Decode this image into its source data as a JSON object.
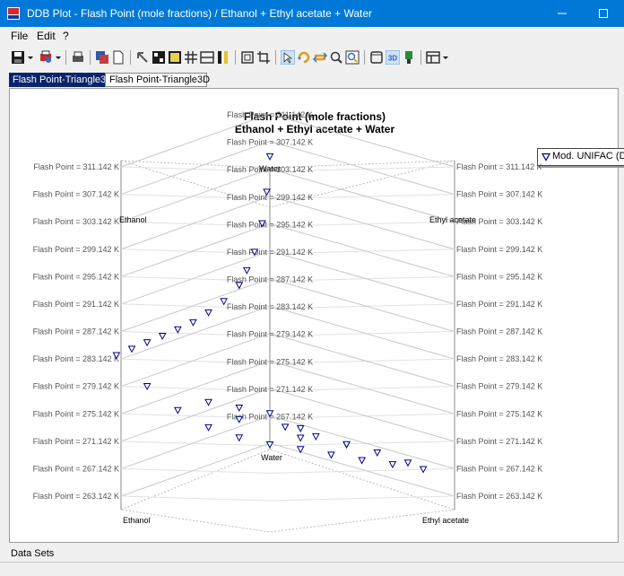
{
  "window": {
    "title": "DDB Plot - Flash Point (mole fractions) / Ethanol + Ethyl acetate + Water",
    "accent": "#0078d7"
  },
  "menu": [
    "File",
    "Edit",
    "?"
  ],
  "toolbar": {
    "icons": [
      "save-icon",
      "dropdown-arrow-icon",
      "print-preview-icon",
      "dropdown-arrow-icon",
      "print-icon",
      "copy-icon",
      "new-page-icon",
      "pointer-icon",
      "grid-small-icon",
      "grid-yellow-icon",
      "grid-icon",
      "table-icon",
      "columns-icon",
      "frame-icon",
      "crop-icon",
      "select-arrow-icon",
      "rotate-icon",
      "move-icon",
      "zoom-icon",
      "zoom-box-icon",
      "window-icon",
      "3d-icon",
      "color-icon",
      "layout-icon",
      "dropdown-arrow-icon"
    ],
    "3d_label": "3D"
  },
  "tabs": [
    "Flash Point-Triangle3D",
    "Flash Point-Triangle3D"
  ],
  "chart_data": {
    "type": "scatter",
    "projection": "ternary-3d",
    "title": "Flash Point (mole fractions)",
    "subtitle": "Ethanol + Ethyl acetate + Water",
    "components": {
      "top": "Water",
      "left": "Ethanol",
      "right": "Ethyl acetate",
      "bottom_left": "Ethanol",
      "bottom_right": "Ethyl acetate",
      "bottom_center": "Water"
    },
    "z_label_prefix": "Flash Point = ",
    "z_unit": "K",
    "z_ticks": [
      311.142,
      307.142,
      303.142,
      299.142,
      295.142,
      291.142,
      287.142,
      283.142,
      279.142,
      275.142,
      271.142,
      267.142,
      263.142
    ],
    "center_labels": [
      311.142,
      307.142,
      303.142,
      299.142,
      295.142,
      291.142,
      287.142,
      283.142,
      279.142,
      275.142,
      271.142,
      267.142
    ],
    "zlim": [
      263.142,
      311.142
    ],
    "legend": {
      "entries": [
        "Mod. UNIFAC (Do)"
      ],
      "placement": "top-right"
    },
    "marker": "triangle-down",
    "marker_color": "#00008b",
    "series": [
      {
        "name": "Mod. UNIFAC (Do)",
        "points": [
          {
            "x_ethanol": 0.0,
            "x_ethyl_acetate": 0.0,
            "z": 311.1
          },
          {
            "x_ethanol": 0.02,
            "x_ethyl_acetate": 0.0,
            "z": 306.0
          },
          {
            "x_ethanol": 0.05,
            "x_ethyl_acetate": 0.0,
            "z": 301.5
          },
          {
            "x_ethanol": 0.1,
            "x_ethyl_acetate": 0.0,
            "z": 297.5
          },
          {
            "x_ethanol": 0.15,
            "x_ethyl_acetate": 0.0,
            "z": 295.0
          },
          {
            "x_ethanol": 0.2,
            "x_ethyl_acetate": 0.0,
            "z": 293.0
          },
          {
            "x_ethanol": 0.3,
            "x_ethyl_acetate": 0.0,
            "z": 291.0
          },
          {
            "x_ethanol": 0.4,
            "x_ethyl_acetate": 0.0,
            "z": 289.7
          },
          {
            "x_ethanol": 0.5,
            "x_ethyl_acetate": 0.0,
            "z": 288.6
          },
          {
            "x_ethanol": 0.6,
            "x_ethyl_acetate": 0.0,
            "z": 287.9
          },
          {
            "x_ethanol": 0.7,
            "x_ethyl_acetate": 0.0,
            "z": 287.3
          },
          {
            "x_ethanol": 0.8,
            "x_ethyl_acetate": 0.0,
            "z": 286.7
          },
          {
            "x_ethanol": 0.9,
            "x_ethyl_acetate": 0.0,
            "z": 286.1
          },
          {
            "x_ethanol": 1.0,
            "x_ethyl_acetate": 0.0,
            "z": 285.5
          },
          {
            "x_ethanol": 0.9,
            "x_ethyl_acetate": 0.1,
            "z": 281.0
          },
          {
            "x_ethanol": 0.8,
            "x_ethyl_acetate": 0.2,
            "z": 277.5
          },
          {
            "x_ethanol": 0.7,
            "x_ethyl_acetate": 0.3,
            "z": 275.0
          },
          {
            "x_ethanol": 0.6,
            "x_ethyl_acetate": 0.4,
            "z": 273.5
          },
          {
            "x_ethanol": 0.5,
            "x_ethyl_acetate": 0.5,
            "z": 272.5
          },
          {
            "x_ethanol": 0.4,
            "x_ethyl_acetate": 0.6,
            "z": 271.8
          },
          {
            "x_ethanol": 0.3,
            "x_ethyl_acetate": 0.7,
            "z": 271.0
          },
          {
            "x_ethanol": 0.2,
            "x_ethyl_acetate": 0.8,
            "z": 270.2
          },
          {
            "x_ethanol": 0.1,
            "x_ethyl_acetate": 0.9,
            "z": 269.6
          },
          {
            "x_ethanol": 0.0,
            "x_ethyl_acetate": 1.0,
            "z": 268.9
          },
          {
            "x_ethanol": 0.0,
            "x_ethyl_acetate": 0.9,
            "z": 269.5
          },
          {
            "x_ethanol": 0.0,
            "x_ethyl_acetate": 0.7,
            "z": 270.3
          },
          {
            "x_ethanol": 0.0,
            "x_ethyl_acetate": 0.5,
            "z": 270.8
          },
          {
            "x_ethanol": 0.0,
            "x_ethyl_acetate": 0.3,
            "z": 271.3
          },
          {
            "x_ethanol": 0.0,
            "x_ethyl_acetate": 0.1,
            "z": 272.0
          },
          {
            "x_ethanol": 0.4,
            "x_ethyl_acetate": 0.2,
            "z": 276.5
          },
          {
            "x_ethanol": 0.2,
            "x_ethyl_acetate": 0.4,
            "z": 273.5
          },
          {
            "x_ethanol": 0.2,
            "x_ethyl_acetate": 0.2,
            "z": 275.0
          },
          {
            "x_ethanol": 0.6,
            "x_ethyl_acetate": 0.2,
            "z": 278.0
          },
          {
            "x_ethanol": 0.3,
            "x_ethyl_acetate": 0.5,
            "z": 272.8
          },
          {
            "x_ethanol": 0.1,
            "x_ethyl_acetate": 0.6,
            "z": 271.5
          },
          {
            "x_ethanol": 0.5,
            "x_ethyl_acetate": 0.3,
            "z": 275.5
          }
        ]
      }
    ]
  },
  "footer": {
    "datasets_label": "Data Sets"
  }
}
